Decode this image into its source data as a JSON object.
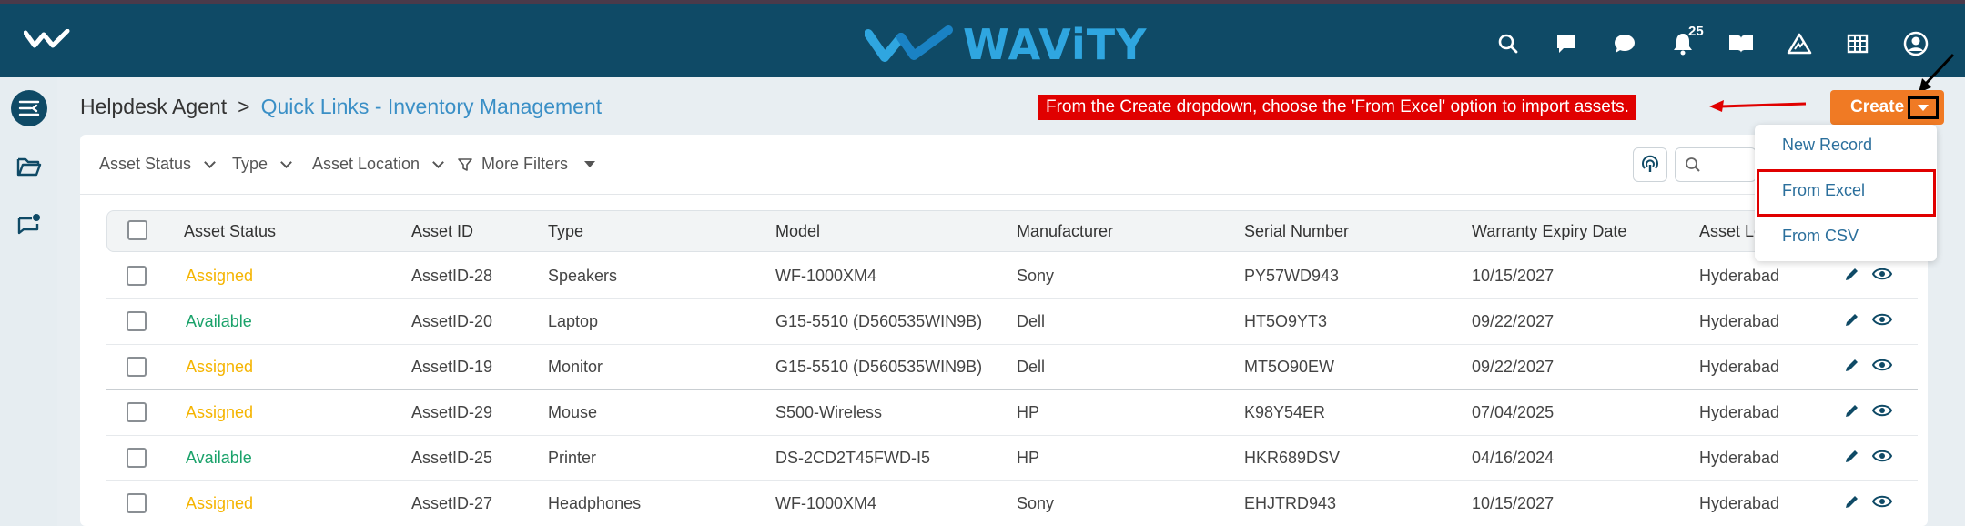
{
  "topbar": {
    "brand": "WAViTY",
    "notification_count": "25",
    "icons": [
      "search-icon",
      "message-icon",
      "chat-icon",
      "bell-icon",
      "book-icon",
      "warning-icon",
      "grid-icon",
      "user-icon"
    ]
  },
  "breadcrumb": {
    "root": "Helpdesk Agent",
    "separator": ">",
    "current": "Quick Links - Inventory Management"
  },
  "annotation": {
    "text": "From the Create dropdown, choose the 'From Excel' option to import assets.",
    "color": "#e00000"
  },
  "toolbar": {
    "create_label": "Create",
    "accent": "#f07a24"
  },
  "create_menu": {
    "items": [
      "New Record",
      "From Excel",
      "From CSV"
    ],
    "highlighted": "From Excel"
  },
  "filters": {
    "asset_status": "Asset Status",
    "type": "Type",
    "asset_location": "Asset Location",
    "more_filters": "More Filters"
  },
  "table": {
    "columns": [
      "Asset Status",
      "Asset ID",
      "Type",
      "Model",
      "Manufacturer",
      "Serial Number",
      "Warranty Expiry Date",
      "Asset Lo"
    ],
    "rows": [
      {
        "status": "Assigned",
        "id": "AssetID-28",
        "type": "Speakers",
        "model": "WF-1000XM4",
        "manufacturer": "Sony",
        "serial": "PY57WD943",
        "warranty": "10/15/2027",
        "location": "Hyderabad"
      },
      {
        "status": "Available",
        "id": "AssetID-20",
        "type": "Laptop",
        "model": "G15-5510 (D560535WIN9B)",
        "manufacturer": "Dell",
        "serial": "HT5O9YT3",
        "warranty": "09/22/2027",
        "location": "Hyderabad"
      },
      {
        "status": "Assigned",
        "id": "AssetID-19",
        "type": "Monitor",
        "model": "G15-5510 (D560535WIN9B)",
        "manufacturer": "Dell",
        "serial": "MT5O90EW",
        "warranty": "09/22/2027",
        "location": "Hyderabad"
      },
      {
        "status": "Assigned",
        "id": "AssetID-29",
        "type": "Mouse",
        "model": "S500-Wireless",
        "manufacturer": "HP",
        "serial": "K98Y54ER",
        "warranty": "07/04/2025",
        "location": "Hyderabad"
      },
      {
        "status": "Available",
        "id": "AssetID-25",
        "type": "Printer",
        "model": "DS-2CD2T45FWD-I5",
        "manufacturer": "HP",
        "serial": "HKR689DSV",
        "warranty": "04/16/2024",
        "location": "Hyderabad"
      },
      {
        "status": "Assigned",
        "id": "AssetID-27",
        "type": "Headphones",
        "model": "WF-1000XM4",
        "manufacturer": "Sony",
        "serial": "EHJTRD943",
        "warranty": "10/15/2027",
        "location": "Hyderabad"
      }
    ]
  },
  "colors": {
    "topbar": "#0f4a66",
    "brand": "#2fa6e0",
    "assigned": "#f5b400",
    "available": "#1aa26a",
    "link": "#3a8fc6"
  }
}
